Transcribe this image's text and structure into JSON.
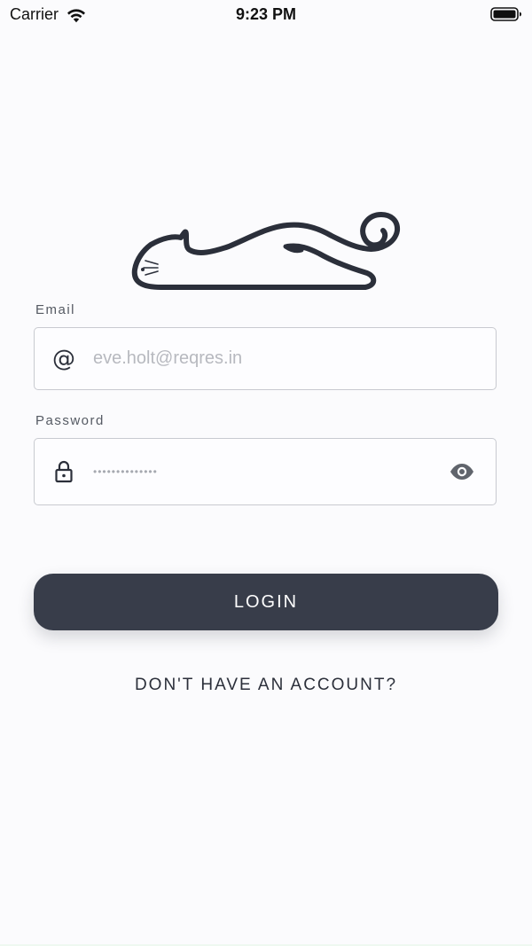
{
  "status_bar": {
    "carrier": "Carrier",
    "time": "9:23 PM",
    "icons": [
      "wifi-icon",
      "battery-icon"
    ]
  },
  "logo": {
    "icon": "cat-logo-icon"
  },
  "form": {
    "email_label": "Email",
    "email_placeholder": "eve.holt@reqres.in",
    "email_icon": "at-icon",
    "password_label": "Password",
    "password_value": "••••••••••••••",
    "password_icon": "lock-icon",
    "password_toggle_icon": "eye-icon"
  },
  "actions": {
    "login_label": "LOGIN",
    "signup_label": "DON'T HAVE AN ACCOUNT?"
  },
  "colors": {
    "background": "#fbfbfd",
    "button": "#383d4a",
    "text": "#2b2f3a",
    "border": "#c8cad0"
  }
}
